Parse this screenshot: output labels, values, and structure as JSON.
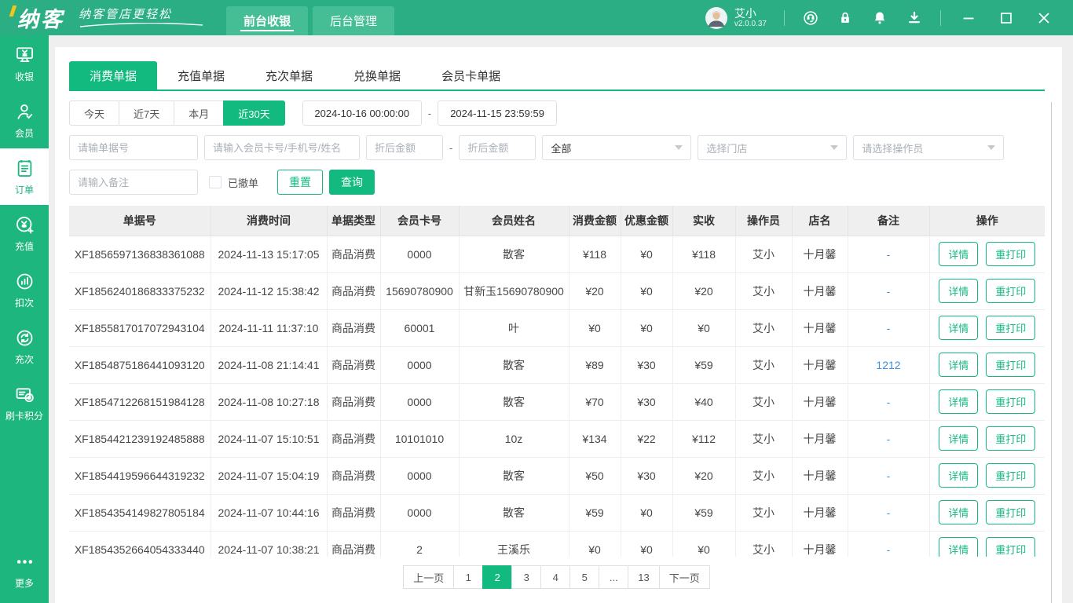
{
  "topbar": {
    "logo_text": "纳客",
    "tagline": "纳客管店更轻松",
    "tabs": [
      {
        "label": "前台收银",
        "active": true
      },
      {
        "label": "后台管理",
        "active": false
      }
    ],
    "user": {
      "name": "艾小",
      "version": "v2.0.0.37"
    },
    "icons": [
      "customer-service-icon",
      "lock-icon",
      "bell-icon",
      "download-icon"
    ]
  },
  "sidebar": {
    "items": [
      {
        "label": "收银",
        "icon": "cashier-icon",
        "active": false
      },
      {
        "label": "会员",
        "icon": "member-icon",
        "active": false
      },
      {
        "label": "订单",
        "icon": "order-icon",
        "active": true
      },
      {
        "label": "充值",
        "icon": "recharge-icon",
        "active": false
      },
      {
        "label": "扣次",
        "icon": "deduct-icon",
        "active": false
      },
      {
        "label": "充次",
        "icon": "refill-icon",
        "active": false
      },
      {
        "label": "刷卡积分",
        "icon": "card-points-icon",
        "active": false
      }
    ],
    "more": {
      "label": "更多",
      "icon": "more-icon"
    }
  },
  "doc_tabs": [
    {
      "label": "消费单据",
      "active": true
    },
    {
      "label": "充值单据",
      "active": false
    },
    {
      "label": "充次单据",
      "active": false
    },
    {
      "label": "兑换单据",
      "active": false
    },
    {
      "label": "会员卡单据",
      "active": false
    }
  ],
  "filters": {
    "quick_ranges": [
      {
        "label": "今天",
        "active": false
      },
      {
        "label": "近7天",
        "active": false
      },
      {
        "label": "本月",
        "active": false
      },
      {
        "label": "近30天",
        "active": true
      }
    ],
    "date_from": "2024-10-16 00:00:00",
    "date_to": "2024-11-15 23:59:59",
    "order_no_placeholder": "请输单据号",
    "member_placeholder": "请输入会员卡号/手机号/姓名",
    "amount_min_placeholder": "折后金额",
    "amount_max_placeholder": "折后金额",
    "type_selected": "全部",
    "store_placeholder": "选择门店",
    "operator_placeholder": "请选择操作员",
    "remark_placeholder": "请输入备注",
    "cancelled_label": "已撤单",
    "reset_label": "重置",
    "query_label": "查询"
  },
  "table": {
    "headers": [
      "单据号",
      "消费时间",
      "单据类型",
      "会员卡号",
      "会员姓名",
      "消费金额",
      "优惠金额",
      "实收",
      "操作员",
      "店名",
      "备注",
      "操作"
    ],
    "detail_label": "详情",
    "reprint_label": "重打印",
    "rows": [
      {
        "order_no": "XF1856597136838361088",
        "time": "2024-11-13 15:17:05",
        "type": "商品消费",
        "card": "0000",
        "name": "散客",
        "amount": "¥118",
        "discount": "¥0",
        "paid": "¥118",
        "operator": "艾小",
        "store": "十月馨",
        "remark": "-"
      },
      {
        "order_no": "XF1856240186833375232",
        "time": "2024-11-12 15:38:42",
        "type": "商品消费",
        "card": "15690780900",
        "name": "甘新玉15690780900",
        "amount": "¥20",
        "discount": "¥0",
        "paid": "¥20",
        "operator": "艾小",
        "store": "十月馨",
        "remark": "-"
      },
      {
        "order_no": "XF1855817017072943104",
        "time": "2024-11-11 11:37:10",
        "type": "商品消费",
        "card": "60001",
        "name": "叶",
        "amount": "¥0",
        "discount": "¥0",
        "paid": "¥0",
        "operator": "艾小",
        "store": "十月馨",
        "remark": "-"
      },
      {
        "order_no": "XF1854875186441093120",
        "time": "2024-11-08 21:14:41",
        "type": "商品消费",
        "card": "0000",
        "name": "散客",
        "amount": "¥89",
        "discount": "¥30",
        "paid": "¥59",
        "operator": "艾小",
        "store": "十月馨",
        "remark": "1212"
      },
      {
        "order_no": "XF1854712268151984128",
        "time": "2024-11-08 10:27:18",
        "type": "商品消费",
        "card": "0000",
        "name": "散客",
        "amount": "¥70",
        "discount": "¥30",
        "paid": "¥40",
        "operator": "艾小",
        "store": "十月馨",
        "remark": "-"
      },
      {
        "order_no": "XF1854421239192485888",
        "time": "2024-11-07 15:10:51",
        "type": "商品消费",
        "card": "10101010",
        "name": "10z",
        "amount": "¥134",
        "discount": "¥22",
        "paid": "¥112",
        "operator": "艾小",
        "store": "十月馨",
        "remark": "-"
      },
      {
        "order_no": "XF1854419596644319232",
        "time": "2024-11-07 15:04:19",
        "type": "商品消费",
        "card": "0000",
        "name": "散客",
        "amount": "¥50",
        "discount": "¥30",
        "paid": "¥20",
        "operator": "艾小",
        "store": "十月馨",
        "remark": "-"
      },
      {
        "order_no": "XF1854354149827805184",
        "time": "2024-11-07 10:44:16",
        "type": "商品消费",
        "card": "0000",
        "name": "散客",
        "amount": "¥59",
        "discount": "¥0",
        "paid": "¥59",
        "operator": "艾小",
        "store": "十月馨",
        "remark": "-"
      },
      {
        "order_no": "XF1854352664054333440",
        "time": "2024-11-07 10:38:21",
        "type": "商品消费",
        "card": "2",
        "name": "王溪乐",
        "amount": "¥0",
        "discount": "¥0",
        "paid": "¥0",
        "operator": "艾小",
        "store": "十月馨",
        "remark": "-"
      }
    ]
  },
  "pagination": {
    "prev_label": "上一页",
    "next_label": "下一页",
    "pages": [
      "1",
      "2",
      "3",
      "4",
      "5",
      "...",
      "13"
    ],
    "active_page": "2"
  },
  "colors": {
    "topbar_green": "#2bae83",
    "sidebar_green": "#1eb67f",
    "accent_green": "#13ba80",
    "link_blue": "#3d8fd8",
    "logo_accent_yellow": "#f5c518"
  }
}
